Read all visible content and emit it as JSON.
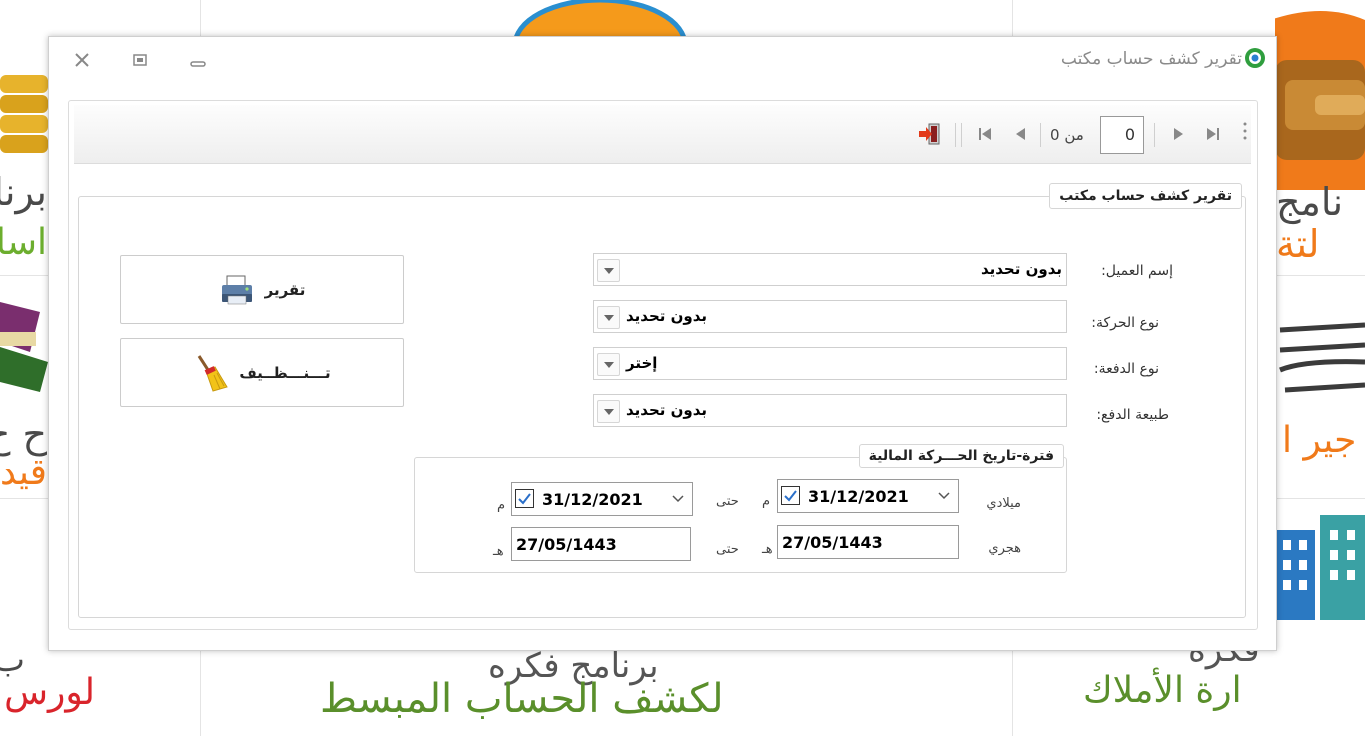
{
  "background": {
    "left_top_text": "برنا",
    "left_top_text2": "اسا",
    "left_mid_text": "ح ح",
    "left_mid_text2": "قيد",
    "left_bottom_text": "ب",
    "left_bottom_red": "لورس",
    "center_bottom_dark": "برنامج فكره",
    "center_bottom_green": "لكشف الحساب المبسط",
    "right_top_text": "نامج",
    "right_top_orange": "لتة",
    "right_mid_orange": "جير ا",
    "right_bottom_dark": "فكره",
    "right_bottom_green": "ارة الأملاك"
  },
  "window": {
    "title": "تقرير كشف حساب مكتب"
  },
  "toolbar": {
    "page_current": "0",
    "of_label": "من 0"
  },
  "form": {
    "group_title": "تقرير كشف حساب مكتب",
    "customer_label": "إسم العميل:",
    "customer_value": "بدون تحديد",
    "movement_type_label": "نوع الحركة:",
    "movement_type_value": "بدون تحديد",
    "payment_type_label": "نوع الدفعة:",
    "payment_type_value": "إختر",
    "payment_nature_label": "طبيعة الدفع:",
    "payment_nature_value": "بدون تحديد",
    "report_button": "تقرير",
    "clear_button": "تـــنـــظــيف"
  },
  "period": {
    "title": "فترة-تاريخ الحـــركة المالية",
    "gregorian_label": "ميلادي",
    "hijri_label": "هجري",
    "to_label": "حتى",
    "gregorian_suffix": "م",
    "hijri_suffix": "هـ",
    "gregorian_from": "31/12/2021",
    "gregorian_to": "31/12/2021",
    "hijri_from": "27/05/1443",
    "hijri_to": "27/05/1443"
  }
}
